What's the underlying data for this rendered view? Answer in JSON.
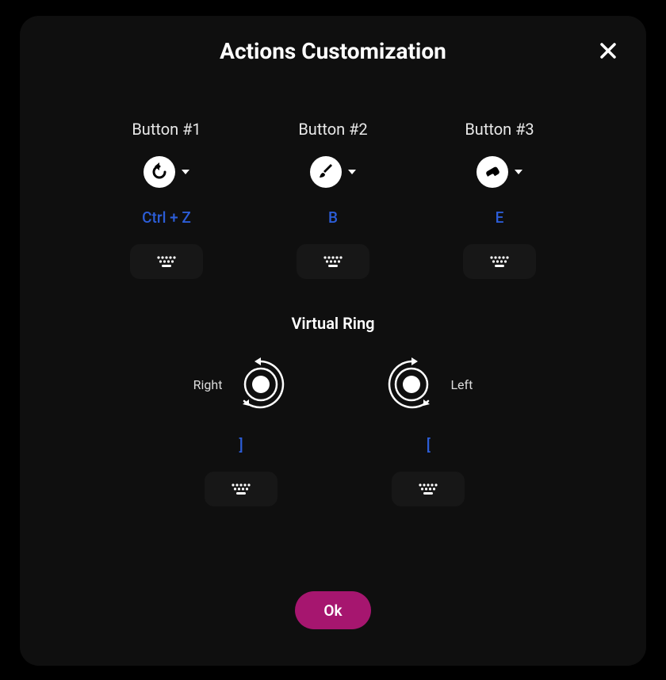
{
  "dialog": {
    "title": "Actions Customization",
    "ok_label": "Ok"
  },
  "buttons": [
    {
      "label": "Button #1",
      "icon": "undo-icon",
      "hotkey": "Ctrl + Z"
    },
    {
      "label": "Button #2",
      "icon": "brush-icon",
      "hotkey": "B"
    },
    {
      "label": "Button #3",
      "icon": "eraser-icon",
      "hotkey": "E"
    }
  ],
  "ring": {
    "title": "Virtual Ring",
    "right": {
      "label": "Right",
      "hotkey": "]"
    },
    "left": {
      "label": "Left",
      "hotkey": "["
    }
  },
  "colors": {
    "accent": "#a6166f",
    "hotkey": "#2c5dd7",
    "panel": "#0f0f0f",
    "sub_panel": "#171717"
  }
}
